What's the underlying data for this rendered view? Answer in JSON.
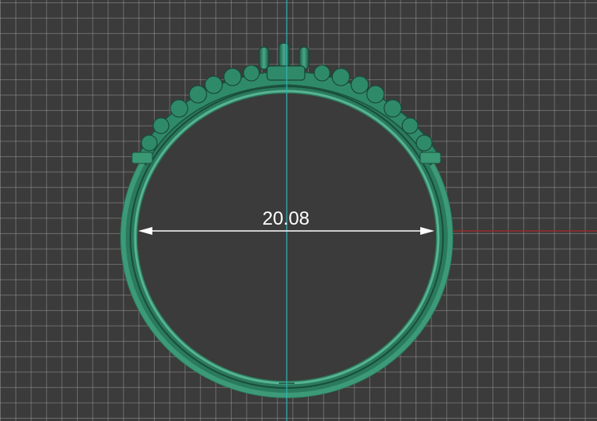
{
  "viewport": {
    "name": "front-view-3d-viewport",
    "background_color": "#3b3b3b",
    "grid_color": "#8a8a8a"
  },
  "axes": {
    "vertical_axis_color": "#2fb4b8",
    "horizontal_axis_color": "#9a2a2a"
  },
  "model": {
    "name": "ring-model",
    "color": "#2f8a6a"
  },
  "measurement": {
    "value": "20.08",
    "color": "#ffffff"
  }
}
